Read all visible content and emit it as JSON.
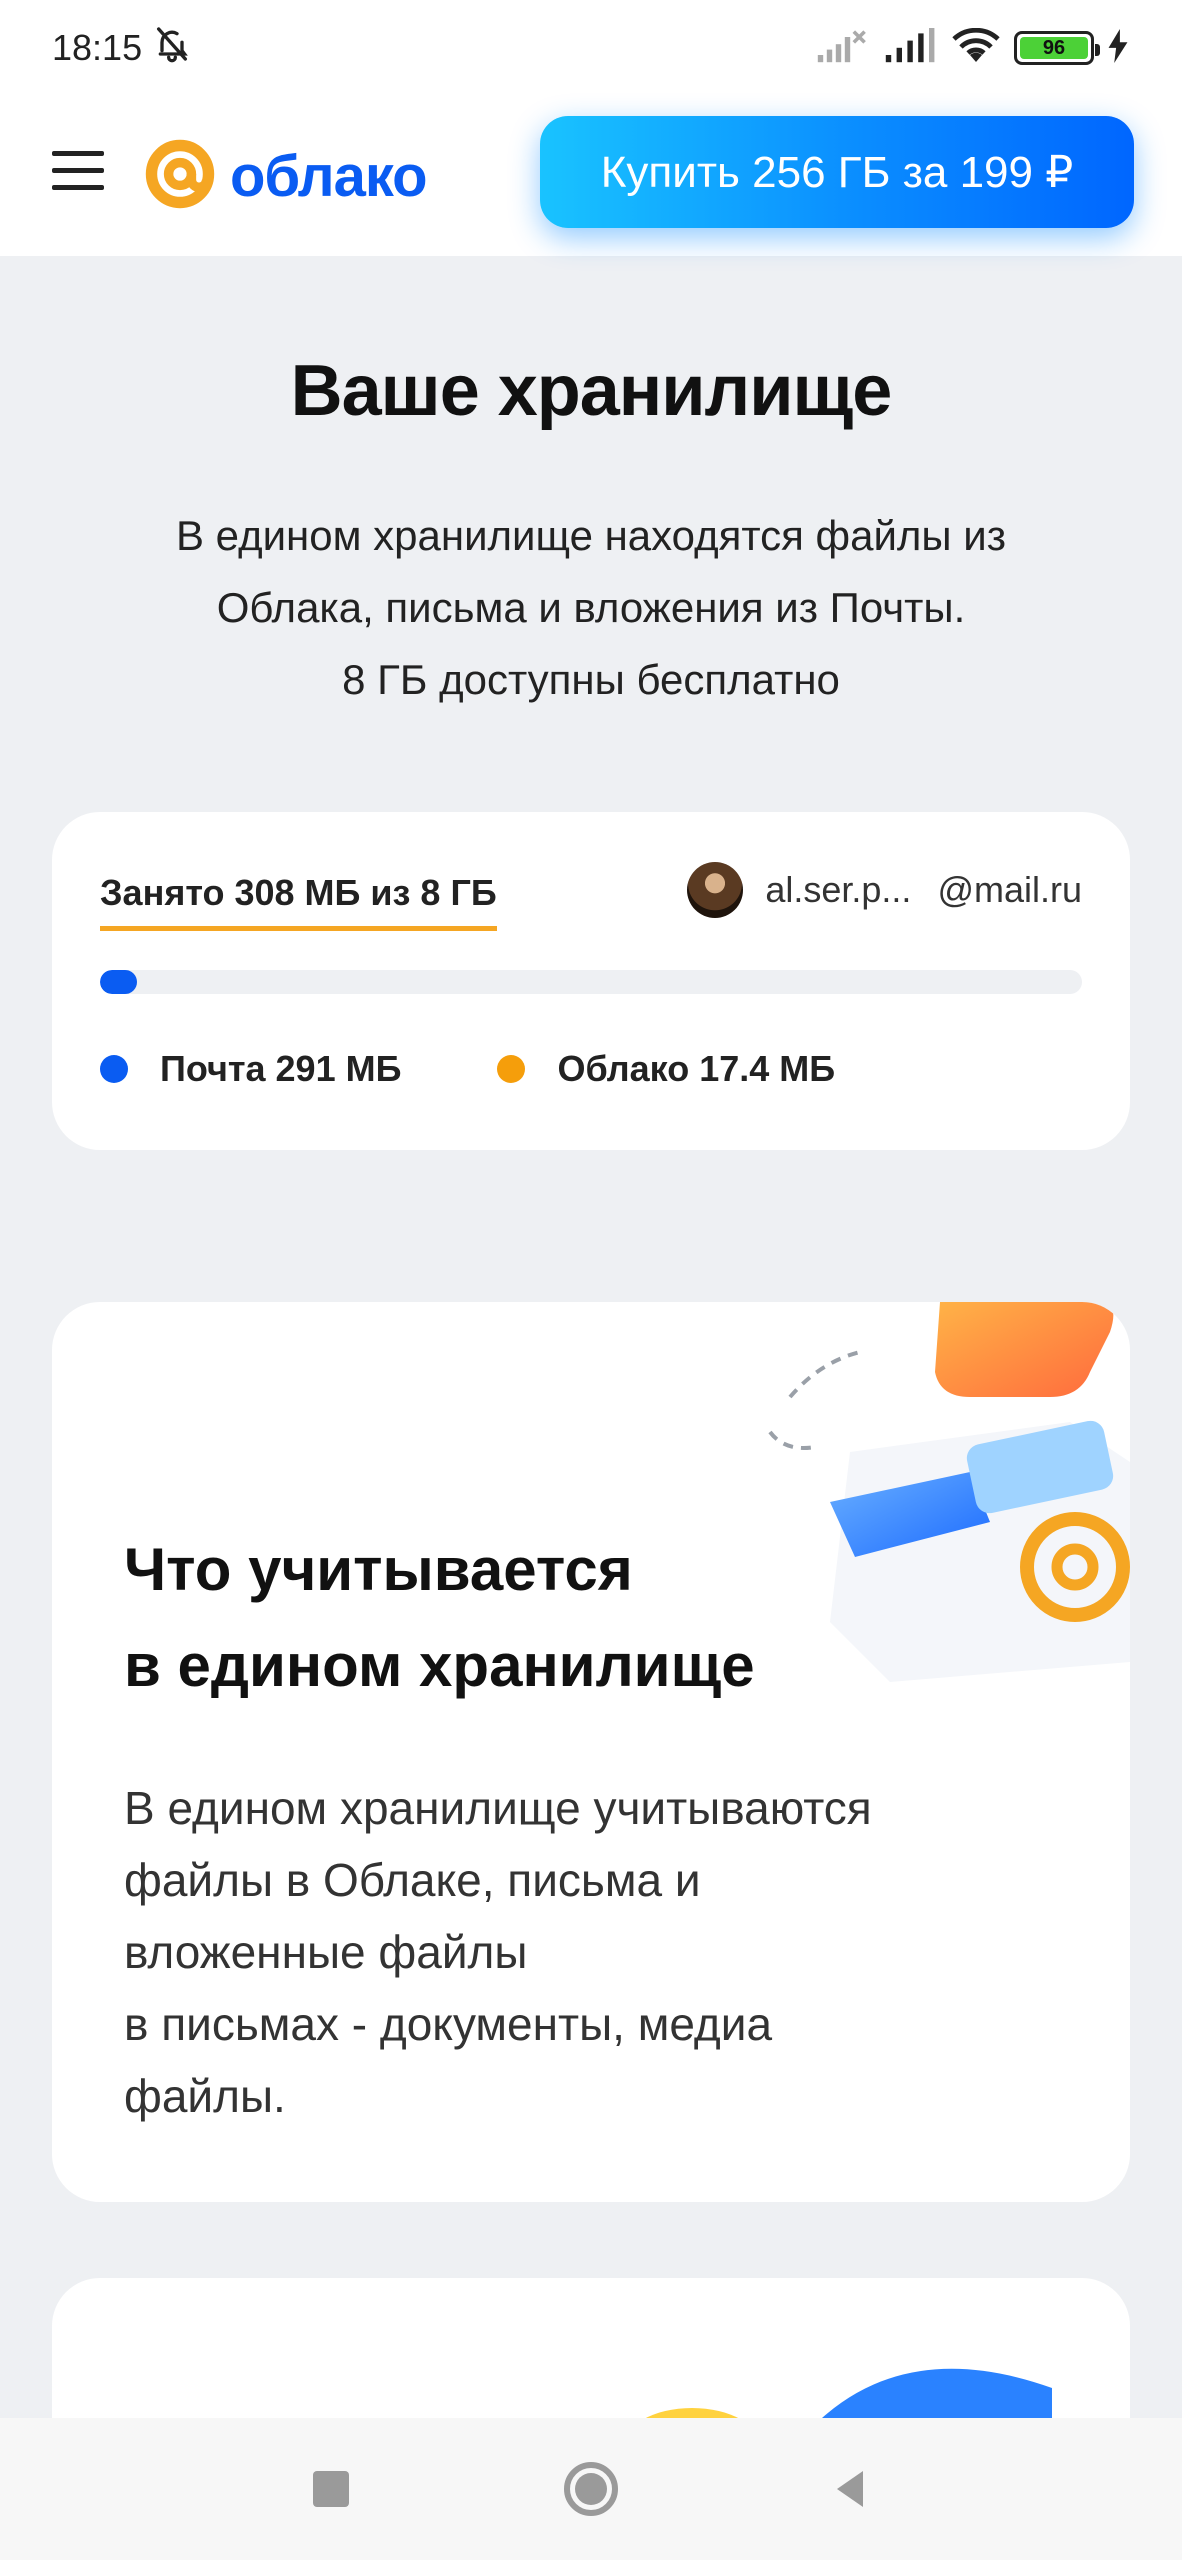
{
  "status_bar": {
    "time": "18:15",
    "battery": "96",
    "icons": [
      "bell-off-icon",
      "signal-x-icon",
      "signal-icon",
      "wifi-icon",
      "battery-icon",
      "charging-icon"
    ]
  },
  "header": {
    "menu_icon": "hamburger-icon",
    "logo_text": "облако",
    "buy_button": "Купить 256 ГБ за 199 ₽"
  },
  "storage": {
    "title": "Ваше хранилище",
    "description": [
      "В едином хранилище находятся файлы из",
      "Облака, письма и вложения из Почты.",
      "8 ГБ доступны бесплатно"
    ],
    "usage": {
      "label": "Занято 308 МБ из 8 ГБ",
      "account_name": "al.ser.p...",
      "account_domain": "@mail.ru",
      "progress": 0.038,
      "legend": [
        {
          "label": "Почта 291 МБ",
          "color": "#0a5cf2"
        },
        {
          "label": "Облако 17.4 МБ",
          "color": "#f59e0b"
        }
      ]
    }
  },
  "info": {
    "title": [
      "Что учитывается",
      "в едином хранилище"
    ],
    "text": [
      "В едином хранилище учитываются",
      "файлы в Облаке, письма и",
      "вложенные файлы",
      "в письмах - документы, медиа",
      "файлы."
    ]
  },
  "nav": {
    "items": [
      "recents-button",
      "home-button",
      "back-button"
    ]
  }
}
